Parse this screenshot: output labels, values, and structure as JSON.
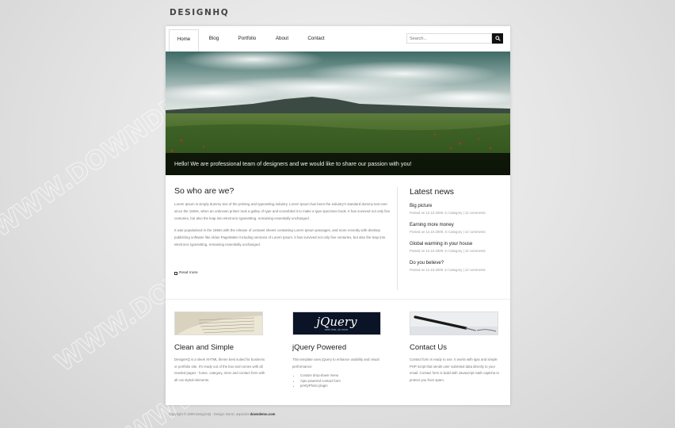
{
  "site": {
    "logo": "DESIGNHQ"
  },
  "nav": {
    "items": [
      {
        "label": "Home"
      },
      {
        "label": "Blog"
      },
      {
        "label": "Portfolio"
      },
      {
        "label": "About"
      },
      {
        "label": "Contact"
      }
    ],
    "search_placeholder": "Search..."
  },
  "hero": {
    "caption": "Hello! We are professional team of designers and we would like to share our passion with you!"
  },
  "about": {
    "title": "So who are we?",
    "para1": "Lorem Ipsum is simply dummy text of the printing and typesetting industry. Lorem Ipsum has been the industry's standard dummy text ever since the 1500s, when an unknown printer took a galley of type and scrambled it to make a type specimen book. It has survived not only five centuries, but also the leap into electronic typesetting, remaining essentially unchanged.",
    "para2": "It was popularised in the 1960s with the release of Letraset sheets containing Lorem Ipsum passages, and more recently with desktop publishing software like Aldus PageMaker including versions of Lorem Ipsum. It has survived not only five centuries, but also the leap into electronic typesetting, remaining essentially unchanged.",
    "readmore": "Read more"
  },
  "news": {
    "title": "Latest news",
    "items": [
      {
        "title": "Big picture",
        "meta": "Posted on 12.10.2009. in Category | 12 comments"
      },
      {
        "title": "Earning more money",
        "meta": "Posted on 12.10.2009. in Category | 12 comments"
      },
      {
        "title": "Global warming in your house",
        "meta": "Posted on 12.10.2009. in Category | 12 comments"
      },
      {
        "title": "Do you believe?",
        "meta": "Posted on 12.10.2009. in Category | 12 comments"
      }
    ]
  },
  "columns": [
    {
      "title": "Clean and Simple",
      "text": "DesignHQ is a sleek XHTML theme best suited for business or portfolio site. It's ready out of the box and comes with all needed pages - home, category, inner and contact form with all css styled elements."
    },
    {
      "title": "jQuery Powered",
      "text": "This template uses jQuery to enhance usability and visual performance:",
      "logo": "jQuery",
      "logo_tag": "write less, do more.",
      "bullets": [
        "Custom drop-down menu",
        "Ajax powered contact form",
        "prettyPhoto plugin"
      ]
    },
    {
      "title": "Contact Us",
      "text": "Contact form is ready to use. It works with ajax and simple PHP script that sends user submited data directly to your email. Contact form is build with Javascript math captcha to protect you from spam."
    }
  ],
  "footer": {
    "text": "Copyright © 2009 DesignHQ - Design: Bonzi, aspnicks",
    "link": "downdemo.com"
  },
  "watermark": "WWW.DOWNDEMO.COM"
}
